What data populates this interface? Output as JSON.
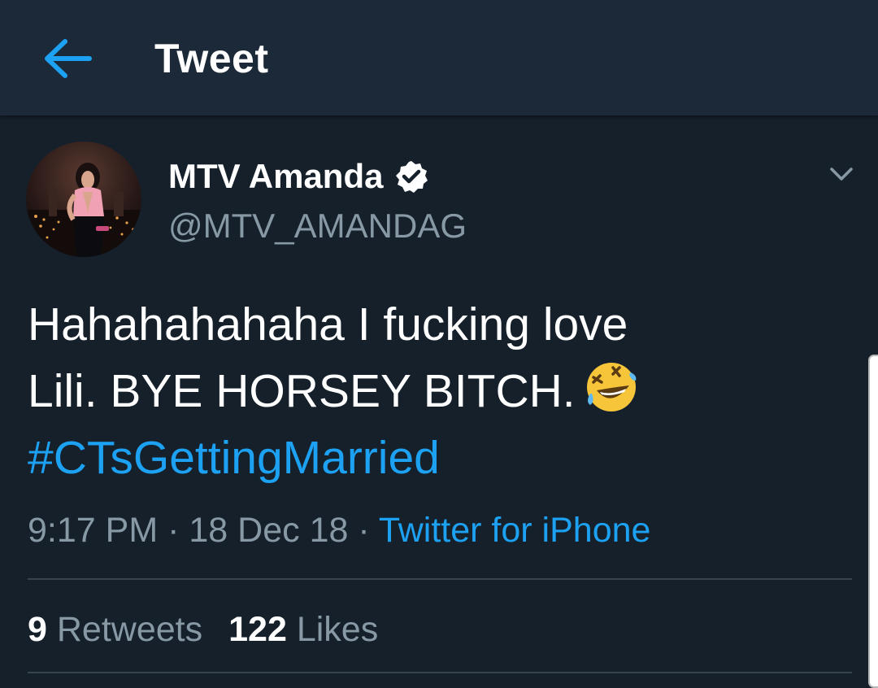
{
  "header": {
    "title": "Tweet",
    "back_icon": "arrow-left-icon"
  },
  "tweet": {
    "author": {
      "name": "MTV Amanda",
      "handle": "@MTV_AMANDAG",
      "verified": true
    },
    "text_line1": "Hahahahahaha I fucking love",
    "text_line2": "Lili. BYE HORSEY BITCH.",
    "emoji": "rolling-on-the-floor-laughing-icon",
    "hashtag": "#CTsGettingMarried",
    "time": "9:17 PM",
    "separator": "·",
    "date": "18 Dec 18",
    "source": "Twitter for iPhone",
    "retweets_count": "9",
    "retweets_label": "Retweets",
    "likes_count": "122",
    "likes_label": "Likes"
  },
  "colors": {
    "background": "#15202b",
    "header": "#1c2938",
    "accent": "#1da1f2",
    "secondary_text": "#8899a6",
    "divider": "#38444d"
  }
}
